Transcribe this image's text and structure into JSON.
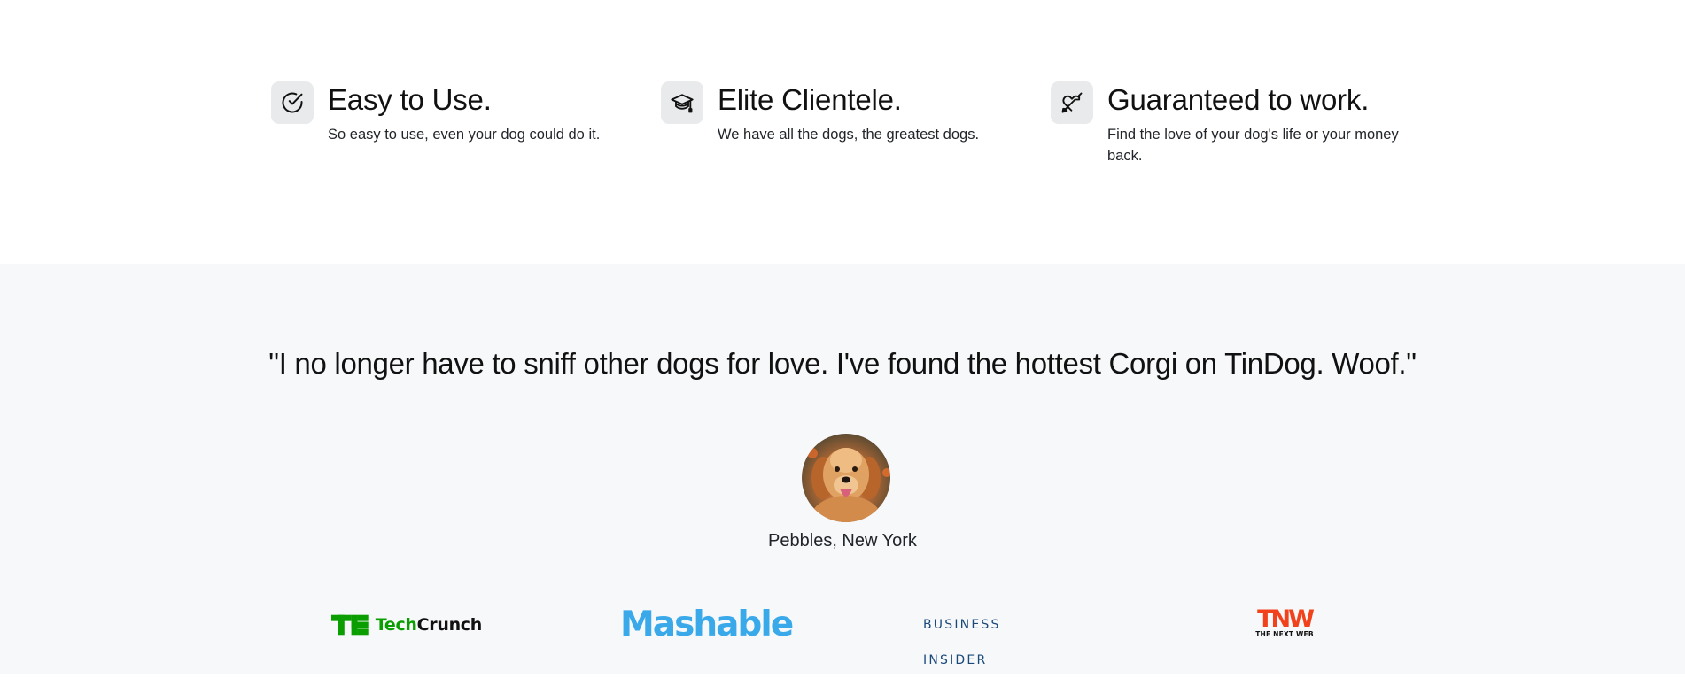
{
  "features": [
    {
      "icon": "check-circle-icon",
      "title": "Easy to Use.",
      "text": "So easy to use, even your dog could do it."
    },
    {
      "icon": "graduation-cap-icon",
      "title": "Elite Clientele.",
      "text": "We have all the dogs, the greatest dogs."
    },
    {
      "icon": "heart-arrow-icon",
      "title": "Guaranteed to work.",
      "text": "Find the love of your dog's life or your money back."
    }
  ],
  "testimonial": {
    "quote": "\"I no longer have to sniff other dogs for love. I've found the hottest Corgi on TinDog. Woof.\"",
    "avatar": "dog-avatar",
    "name": "Pebbles, New York"
  },
  "press": {
    "techcrunch": {
      "tech": "Tech",
      "crunch": "Crunch",
      "color": "#0a9e01"
    },
    "mashable": {
      "label": "Mashable",
      "color": "#3aa9ea"
    },
    "business_insider": {
      "label": "BUSINESS INSIDER",
      "color": "#1a4a7a"
    },
    "tnw": {
      "label": "TNW",
      "sub": "THE NEXT WEB",
      "color": "#f2421b"
    }
  },
  "colors": {
    "testimonial_bg": "#f7f8fa",
    "icon_box_bg": "#e9eaec"
  }
}
